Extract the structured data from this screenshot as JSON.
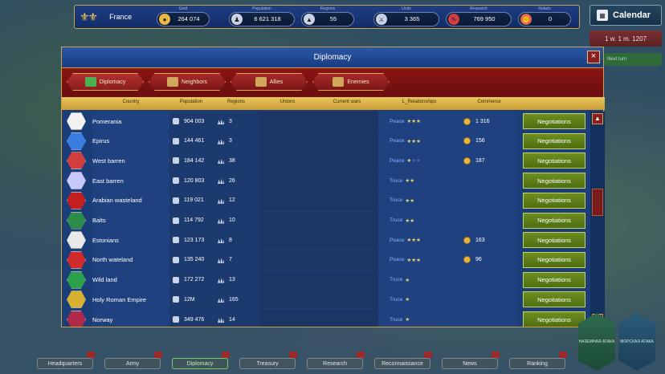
{
  "topbar": {
    "nation": "France",
    "resources": [
      {
        "label": "Gold",
        "value": "264 074",
        "icon": "gold-coin-icon"
      },
      {
        "label": "Population",
        "value": "6 621 318",
        "icon": "population-icon"
      },
      {
        "label": "Regions",
        "value": "55",
        "icon": "regions-icon"
      },
      {
        "label": "Units",
        "value": "3 365",
        "icon": "units-icon"
      },
      {
        "label": "Research",
        "value": "769 950",
        "icon": "research-icon"
      },
      {
        "label": "Rebels",
        "value": "0",
        "icon": "rebels-icon"
      }
    ]
  },
  "hud": {
    "calendar_title": "Calendar",
    "date": "1 w. 1 m. 1207",
    "next_turn": "Next turn"
  },
  "diplomacy": {
    "title": "Diplomacy",
    "close_label": "×",
    "tabs": [
      {
        "label": "Diplomacy"
      },
      {
        "label": "Neighbors"
      },
      {
        "label": "Allies"
      },
      {
        "label": "Enemies"
      }
    ],
    "columns": {
      "country": "Country",
      "population": "Population",
      "regions": "Regions",
      "unions": "Unions",
      "wars": "Current wars",
      "relationships": "L_Relationships",
      "commerce": "Commerce"
    },
    "action_label": "Negotiations",
    "rows": [
      {
        "country": "Pomerania",
        "population": "904 003",
        "regions": "3",
        "relation": "Peace",
        "stars": 3,
        "commerce": "1 316",
        "flag": "#f2f2f2"
      },
      {
        "country": "Epirus",
        "population": "144 461",
        "regions": "3",
        "relation": "Peace",
        "stars": 3,
        "commerce": "156",
        "flag": "#3a7de0"
      },
      {
        "country": "West barren",
        "population": "184 142",
        "regions": "38",
        "relation": "Peace",
        "stars": 1,
        "commerce": "187",
        "flag": "#d23d3d"
      },
      {
        "country": "East barren",
        "population": "120 803",
        "regions": "26",
        "relation": "Truce",
        "stars": 2,
        "commerce": "",
        "flag": "#c8c8ff"
      },
      {
        "country": "Arabian wasteland",
        "population": "119 021",
        "regions": "12",
        "relation": "Truce",
        "stars": 2,
        "commerce": "",
        "flag": "#c42020"
      },
      {
        "country": "Balts",
        "population": "114 792",
        "regions": "10",
        "relation": "Truce",
        "stars": 2,
        "commerce": "",
        "flag": "#2c8c4a"
      },
      {
        "country": "Estonians",
        "population": "123 173",
        "regions": "8",
        "relation": "Peace",
        "stars": 3,
        "commerce": "163",
        "flag": "#e8e8e8"
      },
      {
        "country": "North wateland",
        "population": "135 240",
        "regions": "7",
        "relation": "Peace",
        "stars": 3,
        "commerce": "96",
        "flag": "#d02a2a"
      },
      {
        "country": "Wild land",
        "population": "172 272",
        "regions": "13",
        "relation": "Truce",
        "stars": 1,
        "commerce": "",
        "flag": "#2aa04a"
      },
      {
        "country": "Holy Roman Empire",
        "population": "12M",
        "regions": "165",
        "relation": "Truce",
        "stars": 1,
        "commerce": "",
        "flag": "#d8b030"
      },
      {
        "country": "Norway",
        "population": "349 476",
        "regions": "14",
        "relation": "Truce",
        "stars": 1,
        "commerce": "",
        "flag": "#b02a4a"
      }
    ]
  },
  "bottomnav": {
    "items": [
      {
        "label": "Headquarters"
      },
      {
        "label": "Army"
      },
      {
        "label": "Diplomacy"
      },
      {
        "label": "Treasury"
      },
      {
        "label": "Research"
      },
      {
        "label": "Reconnaissance"
      },
      {
        "label": "News"
      },
      {
        "label": "Ranking"
      }
    ],
    "right_buttons": [
      {
        "label": "НАЗЕМНАЯ АТАКА"
      },
      {
        "label": "МОРСКАЯ АТАКА"
      }
    ]
  },
  "colors": {
    "panel_blue": "#1b3d78",
    "header_gold": "#e9c65c",
    "tab_red": "#8a1414",
    "negotiate_green": "#6d8e1e",
    "relation_blue": "#7fb6ff",
    "star_gold": "#e7d46a"
  }
}
